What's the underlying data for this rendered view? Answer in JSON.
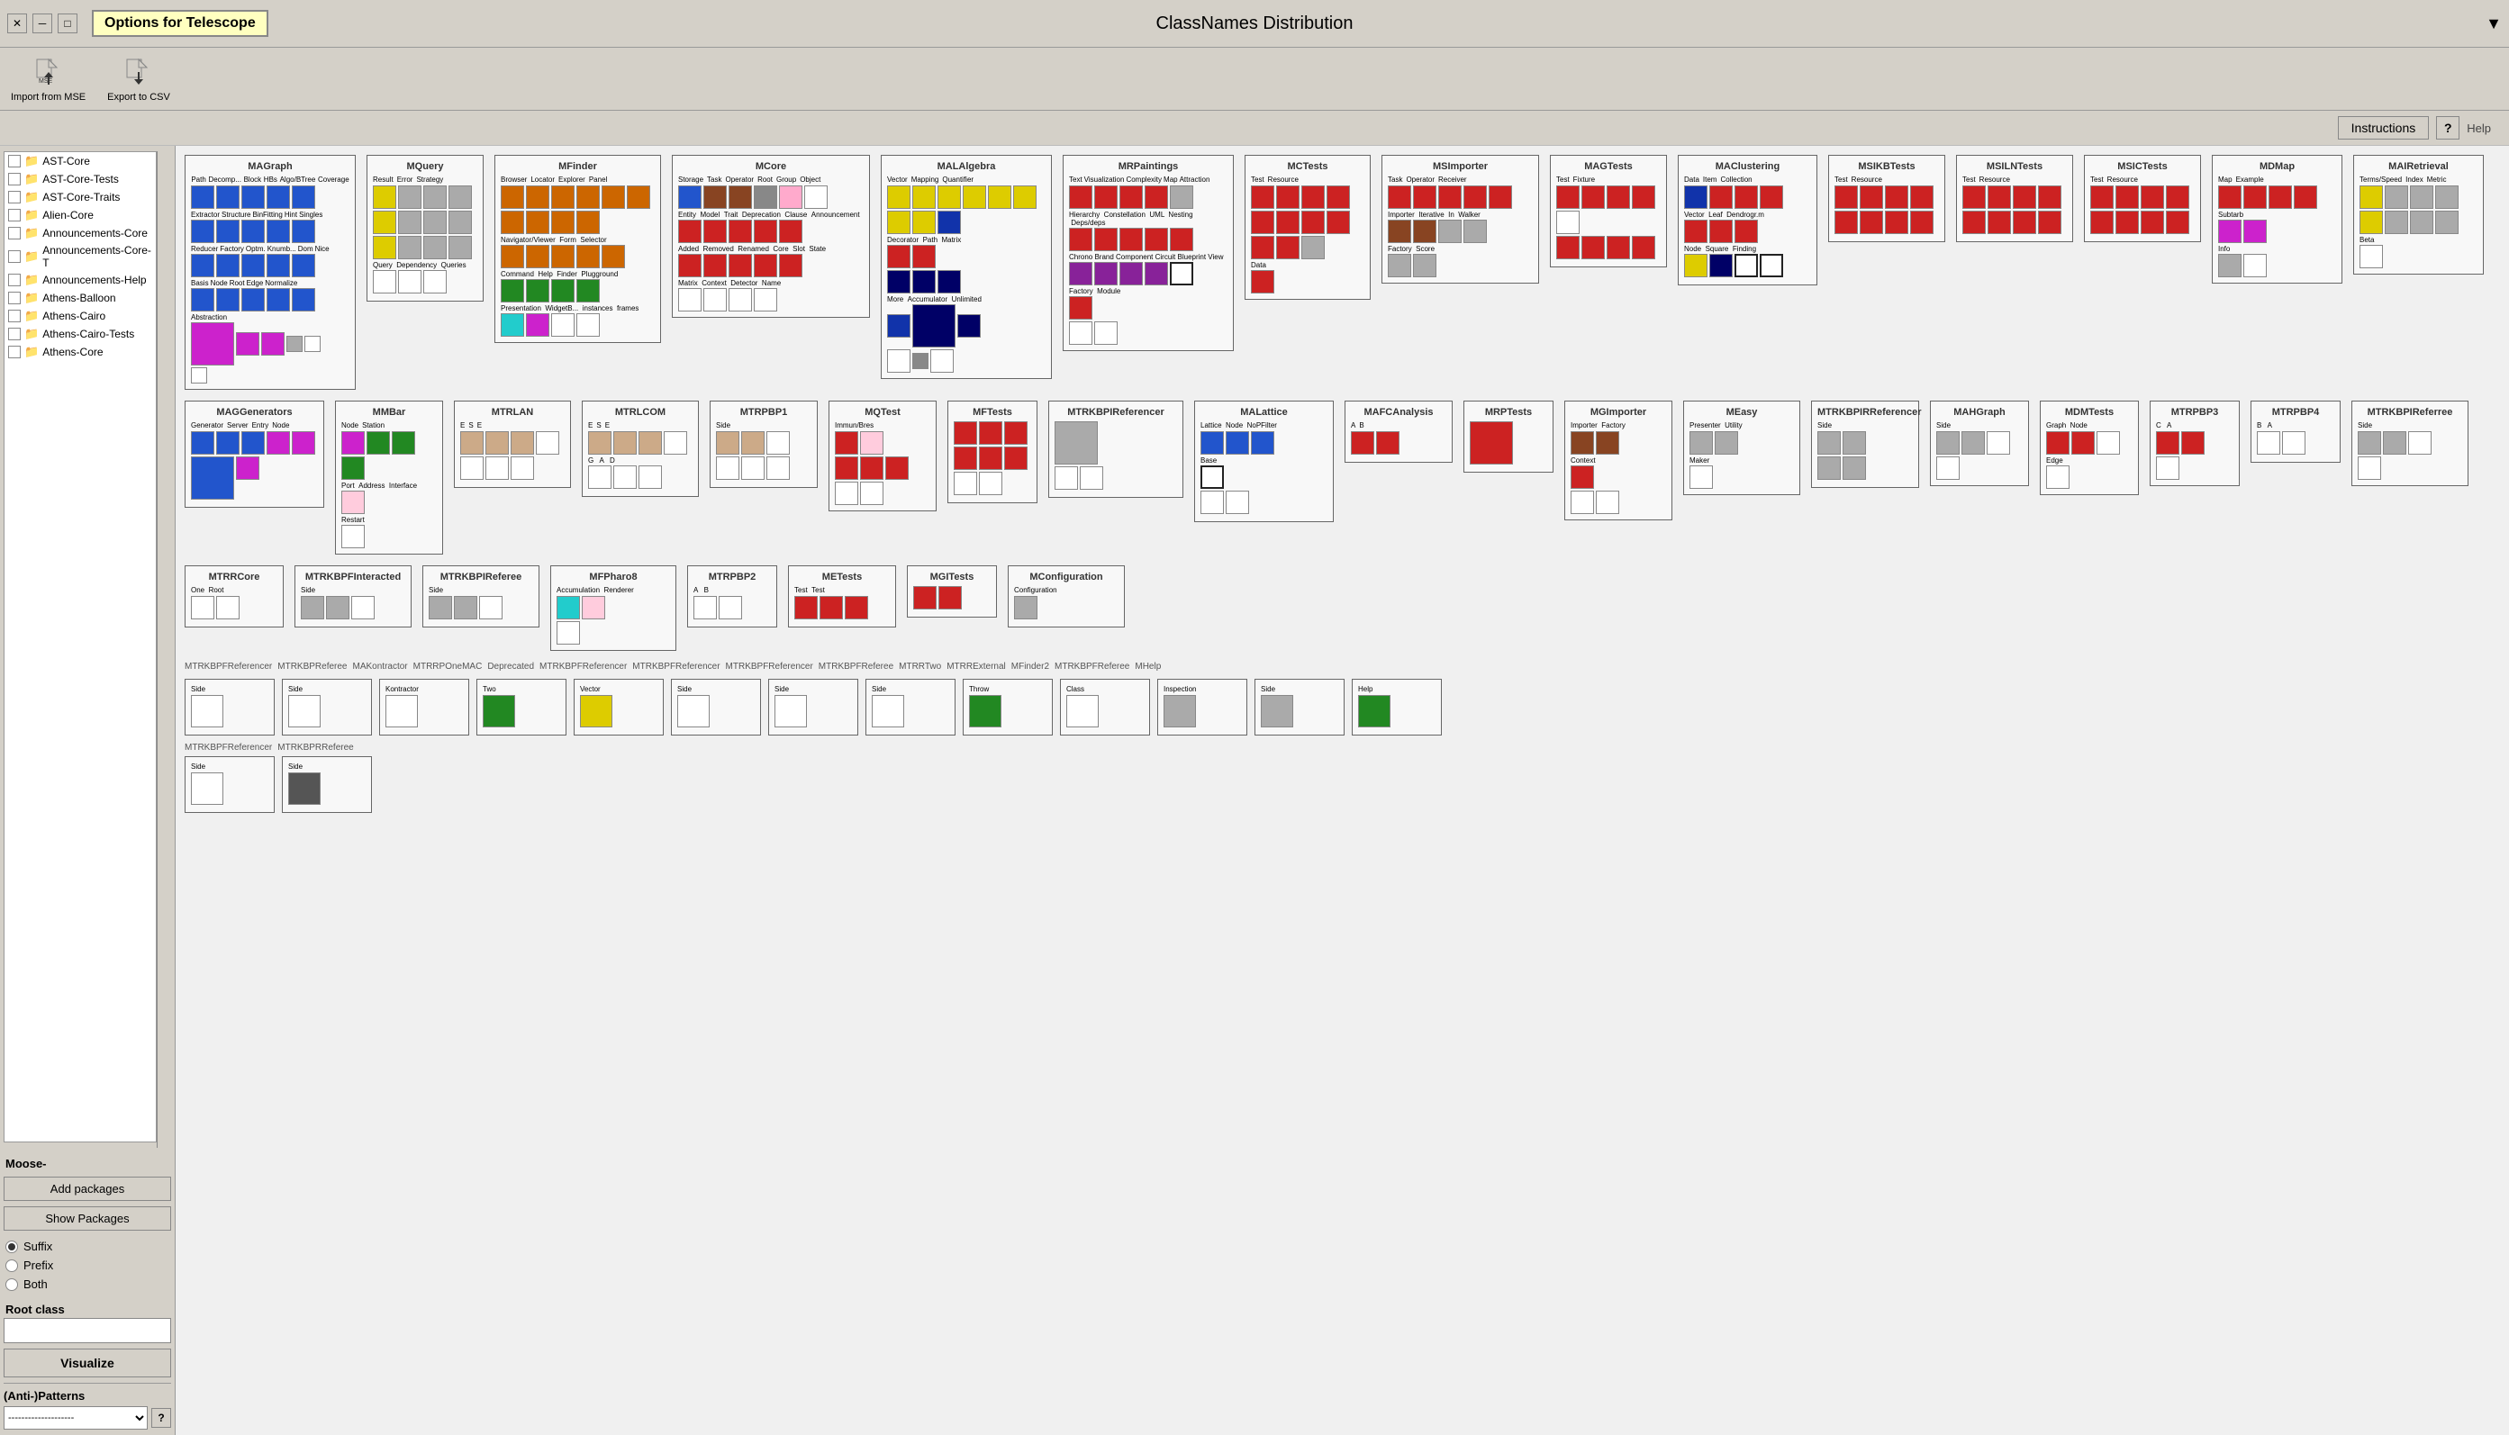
{
  "titleBar": {
    "title": "ClassNames Distribution",
    "optionsLabel": "Options for Telescope",
    "dropdownArrow": "▼"
  },
  "toolbar": {
    "importLabel": "Import from MSE",
    "exportLabel": "Export to CSV"
  },
  "instructions": {
    "buttonLabel": "Instructions",
    "helpLabel": "Help",
    "helpIcon": "?"
  },
  "leftPanel": {
    "treeItems": [
      "AST-Core",
      "AST-Core-Tests",
      "AST-Core-Traits",
      "Alien-Core",
      "Announcements-Core",
      "Announcements-Core-T",
      "Announcements-Help",
      "Athens-Balloon",
      "Athens-Cairo",
      "Athens-Cairo-Tests",
      "Athens-Core"
    ],
    "mooseLabel": "Moose-",
    "addPackagesLabel": "Add packages",
    "showPackagesLabel": "Show Packages",
    "radioOptions": [
      {
        "id": "suffix",
        "label": "Suffix",
        "selected": true
      },
      {
        "id": "prefix",
        "label": "Prefix",
        "selected": false
      },
      {
        "id": "both",
        "label": "Both",
        "selected": false
      }
    ],
    "rootClassLabel": "Root class",
    "rootClassValue": "",
    "visualizeLabel": "Visualize",
    "antiPatternsLabel": "(Anti-)Patterns",
    "antiPatternsPlaceholder": "--------------------",
    "helpIcon": "?"
  },
  "packages": [
    {
      "title": "MAGraph"
    },
    {
      "title": "MQuery"
    },
    {
      "title": "MFinder"
    },
    {
      "title": "MCore"
    },
    {
      "title": "MALAlgebra"
    },
    {
      "title": "MRPaintings"
    },
    {
      "title": "MCTests"
    },
    {
      "title": "MSImporter"
    },
    {
      "title": "MAGTests"
    },
    {
      "title": "MAClustering"
    },
    {
      "title": "MSIKBTests"
    },
    {
      "title": "MSILNTests"
    },
    {
      "title": "MSICTests"
    },
    {
      "title": "MDMap"
    },
    {
      "title": "MAIRetrieval"
    },
    {
      "title": "MAGGenerators"
    },
    {
      "title": "MMBar"
    },
    {
      "title": "MTRLAN"
    },
    {
      "title": "MTRLCOM"
    },
    {
      "title": "MTRPBP1"
    },
    {
      "title": "MQTest"
    },
    {
      "title": "MFTests"
    },
    {
      "title": "MTRKBPIReferencer"
    },
    {
      "title": "MALattice"
    },
    {
      "title": "MAFCAnalysis"
    },
    {
      "title": "MRPTests"
    },
    {
      "title": "MGImporter"
    },
    {
      "title": "MEasy"
    },
    {
      "title": "MTRKBPIRReferencer"
    },
    {
      "title": "MAHGraph"
    },
    {
      "title": "MDMTests"
    },
    {
      "title": "MTRPBP3"
    },
    {
      "title": "MTRPBP4"
    },
    {
      "title": "MTRKBPIReferree"
    },
    {
      "title": "MTRRCore"
    },
    {
      "title": "MTRKBPFInteracted"
    },
    {
      "title": "MTRKBPIReferee"
    },
    {
      "title": "MFPharo8"
    },
    {
      "title": "MTRPBP2"
    },
    {
      "title": "METests"
    },
    {
      "title": "MGITests"
    },
    {
      "title": "MConfiguration"
    }
  ]
}
